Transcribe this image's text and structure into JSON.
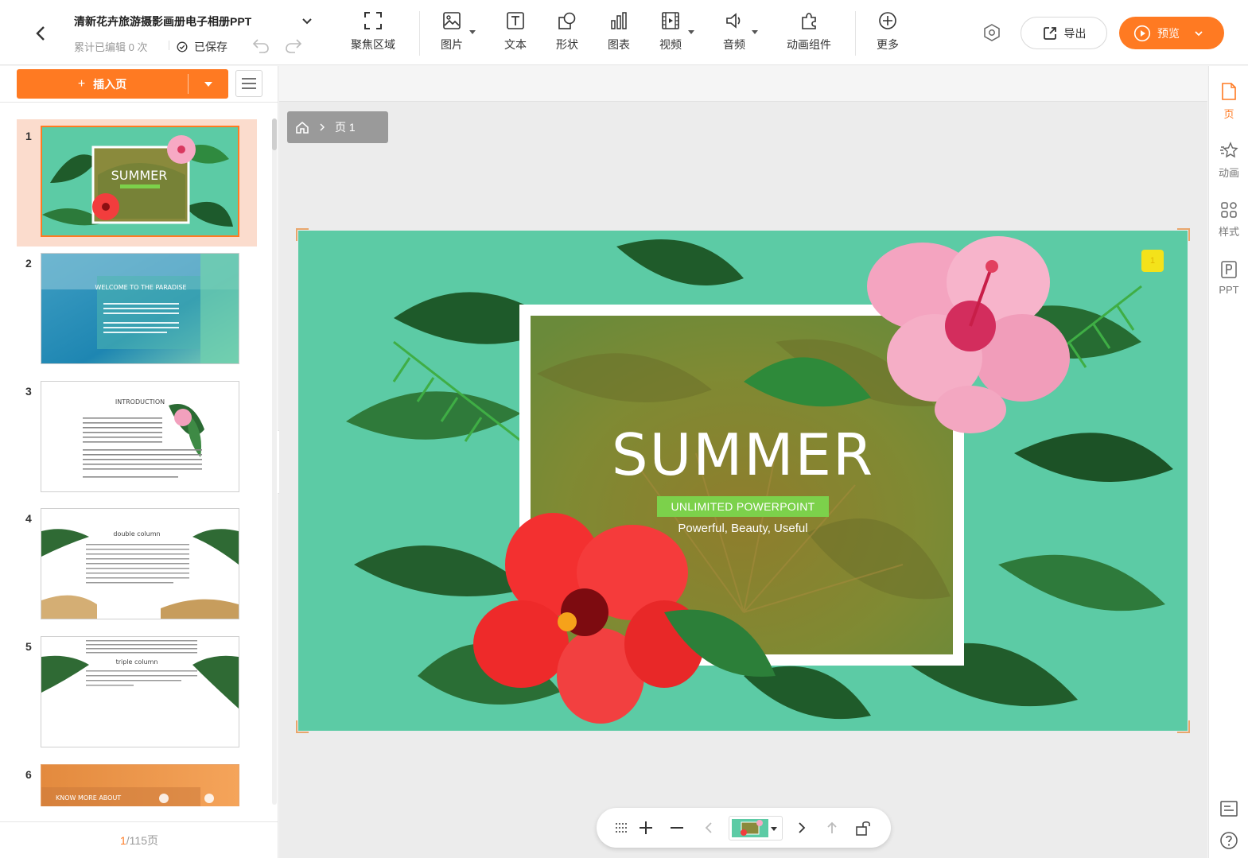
{
  "header": {
    "doc_title": "清新花卉旅游摄影画册电子相册PPT",
    "edit_count": "累计已编辑 0 次",
    "saved_label": "已保存",
    "export_label": "导出",
    "preview_label": "预览"
  },
  "toolbar": {
    "items": [
      {
        "label": "聚焦区域",
        "icon": "focus-area-icon"
      },
      {
        "label": "图片",
        "icon": "image-icon"
      },
      {
        "label": "文本",
        "icon": "text-icon"
      },
      {
        "label": "形状",
        "icon": "shape-icon"
      },
      {
        "label": "图表",
        "icon": "chart-icon"
      },
      {
        "label": "视频",
        "icon": "video-icon"
      },
      {
        "label": "音频",
        "icon": "audio-icon"
      },
      {
        "label": "动画组件",
        "icon": "puzzle-icon"
      },
      {
        "label": "更多",
        "icon": "plus-circle-icon"
      }
    ]
  },
  "left_panel": {
    "insert_label": "插入页",
    "thumbnails": [
      {
        "num": "1",
        "text": "SUMMER"
      },
      {
        "num": "2",
        "text": "WELCOME TO THE PARADISE"
      },
      {
        "num": "3",
        "text": "INTRODUCTION"
      },
      {
        "num": "4",
        "text": "double column"
      },
      {
        "num": "5",
        "text": "triple column"
      },
      {
        "num": "6",
        "text": "KNOW MORE ABOUT"
      }
    ],
    "page_current": "1",
    "page_total": "/115页"
  },
  "canvas": {
    "breadcrumb_page": "页 1",
    "slide": {
      "title": "SUMMER",
      "ribbon": "UNLIMITED POWERPOINT",
      "subtitle": "Powerful, Beauty, Useful",
      "badge": "1"
    }
  },
  "right_sidebar": {
    "items": [
      {
        "label": "页",
        "icon": "page-icon"
      },
      {
        "label": "动画",
        "icon": "animation-star-icon"
      },
      {
        "label": "样式",
        "icon": "style-grid-icon"
      },
      {
        "label": "PPT",
        "icon": "ppt-icon"
      }
    ]
  },
  "colors": {
    "accent": "#ff7a22",
    "slide_bg": "#5ccba5",
    "ribbon": "#7cd14b",
    "active_thumb_bg": "#fbdccd"
  }
}
